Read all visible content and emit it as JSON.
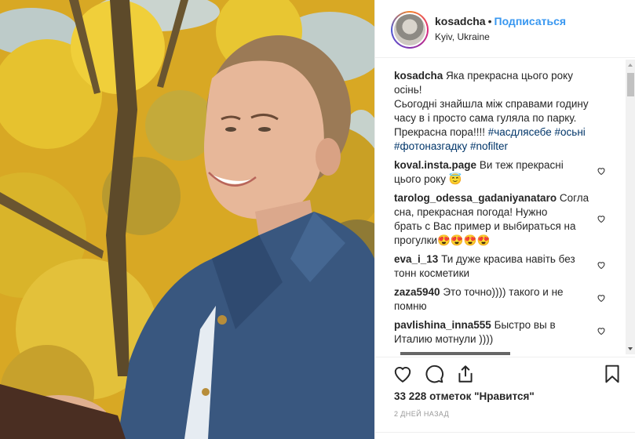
{
  "post": {
    "photo_icon": "autumn-portrait-photo",
    "header": {
      "username": "kosadcha",
      "separator": "•",
      "follow_label": "Подписаться",
      "location": "Kyiv, Ukraine"
    },
    "caption": {
      "user": "kosadcha",
      "text_lines": [
        "Яка прекрасна цього року",
        "осінь!",
        "Сьогодні знайшла між справами годину",
        "часу в і просто сама гуляла по парку.",
        "Прекрасна пора!!!! "
      ],
      "tags_line1": [
        "#часдлясебе",
        "#осьні"
      ],
      "tags_line2": [
        "#фотоназгадку",
        "#nofilter"
      ]
    },
    "comments": [
      {
        "user": "koval.insta.page",
        "lines": [
          "Ви теж прекрасні",
          "цього року 😇"
        ]
      },
      {
        "user": "tarolog_odessa_gadaniyanataro",
        "lines": [
          "Согла",
          "сна, прекрасная погода! Нужно",
          "брать с Вас пример и выбираться на",
          "прогулки😍😍😍😍"
        ]
      },
      {
        "user": "eva_i_13",
        "lines": [
          "Ти дуже красива навіть без",
          "тонн косметики"
        ]
      },
      {
        "user": "zaza5940",
        "lines": [
          "Это точно)))) такого и не",
          "помню"
        ]
      },
      {
        "user": "pavlishina_inna555",
        "lines": [
          "Быстро вы в",
          "Италию мотнули ))))"
        ]
      }
    ],
    "likes": {
      "count": "33 228",
      "suffix": "отметок \"Нравится\""
    },
    "date": "2 дней назад",
    "icons": {
      "like": "heart-icon",
      "comment": "comment-icon",
      "share": "share-icon",
      "save": "bookmark-icon",
      "comment_like": "heart-icon"
    },
    "colors": {
      "link": "#3897f0",
      "hashtag": "#003569",
      "text": "#262626",
      "muted": "#999999"
    }
  }
}
